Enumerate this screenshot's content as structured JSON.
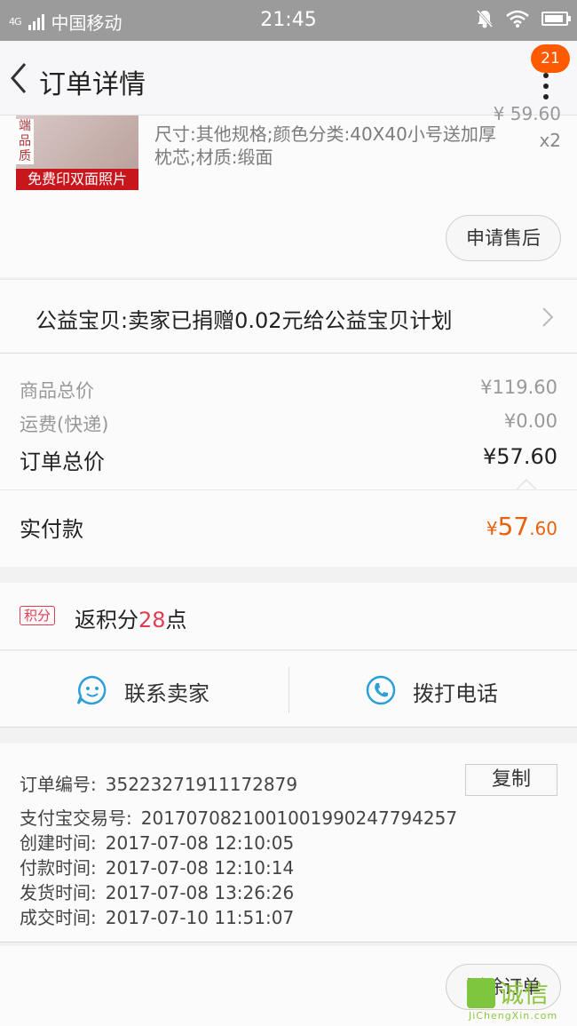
{
  "status_bar": {
    "network": "4G",
    "carrier": "中国移动",
    "time": "21:45"
  },
  "header": {
    "title": "订单详情",
    "notification_badge": "21"
  },
  "item": {
    "thumb_tag": "端品质",
    "thumb_banner": "免费印双面照片",
    "price_partial": "¥ 59.60",
    "specs": "尺寸:其他规格;颜色分类:40X40小号送加厚枕芯;材质:缎面",
    "quantity": "x2",
    "after_sale_button": "申请售后"
  },
  "charity": {
    "text": "公益宝贝:卖家已捐赠0.02元给公益宝贝计划"
  },
  "summary": {
    "goods_total_label": "商品总价",
    "goods_total_value": "¥119.60",
    "shipping_label": "运费(快递)",
    "shipping_value": "¥0.00",
    "order_total_label": "订单总价",
    "order_total_value": "¥57.60",
    "paid_label": "实付款",
    "paid_currency": "¥",
    "paid_int": "57",
    "paid_dec": ".60"
  },
  "points": {
    "tag": "积分",
    "prefix": "返积分",
    "amount": "28",
    "suffix": "点"
  },
  "contact": {
    "seller_label": "联系卖家",
    "call_label": "拨打电话"
  },
  "order_info": {
    "order_no_label": "订单编号:",
    "order_no": "35223271911172879",
    "copy_button": "复制",
    "alipay_label": "支付宝交易号:",
    "alipay_no": "2017070821001001990247794257",
    "created_label": "创建时间:",
    "created": "2017-07-08 12:10:05",
    "paid_label": "付款时间:",
    "paid": "2017-07-08 12:10:14",
    "shipped_label": "发货时间:",
    "shipped": "2017-07-08 13:26:26",
    "closed_label": "成交时间:",
    "closed": "2017-07-10 11:51:07"
  },
  "footer": {
    "delete_button": "删除订单"
  },
  "watermark": {
    "text": "诚信",
    "sub": "JiChengXin.com"
  },
  "colors": {
    "accent_orange": "#e8620c",
    "badge": "#ff5a00",
    "points_red": "#e03c53",
    "icon_blue": "#2a9fd8"
  }
}
